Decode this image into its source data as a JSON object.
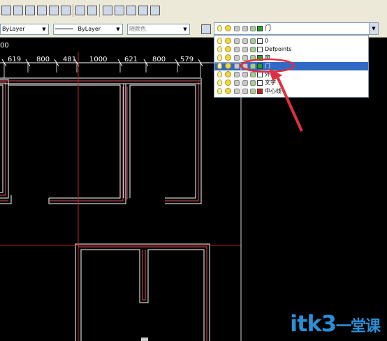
{
  "toolbar": {
    "linetype_combo": "ByLayer",
    "lineweight_combo": "ByLayer",
    "color_combo": "随颜色"
  },
  "layer_control": {
    "current_layer": "门",
    "layers": [
      {
        "name": "0",
        "color": "#ffffff"
      },
      {
        "name": "Defpoints",
        "color": "#ffffff"
      },
      {
        "name": "窗",
        "color": "#2aa02a"
      },
      {
        "name": "门",
        "color": "#2aa02a",
        "selected": true
      },
      {
        "name": "外墙",
        "color": "#ffffff"
      },
      {
        "name": "文字",
        "color": "#ffffff"
      },
      {
        "name": "中心线",
        "color": "#c02020"
      }
    ]
  },
  "drawing": {
    "top_label": "00",
    "dimensions": [
      "619",
      "800",
      "481",
      "1000",
      "621",
      "800",
      "579"
    ]
  },
  "watermark": {
    "latin": "itk3",
    "chinese": "一堂课"
  },
  "colors": {
    "wall": "#ffffff",
    "wall_hatch": "#e05060",
    "centerline": "#c02030",
    "annotation": "#e03040",
    "selection": "#316AC5"
  }
}
